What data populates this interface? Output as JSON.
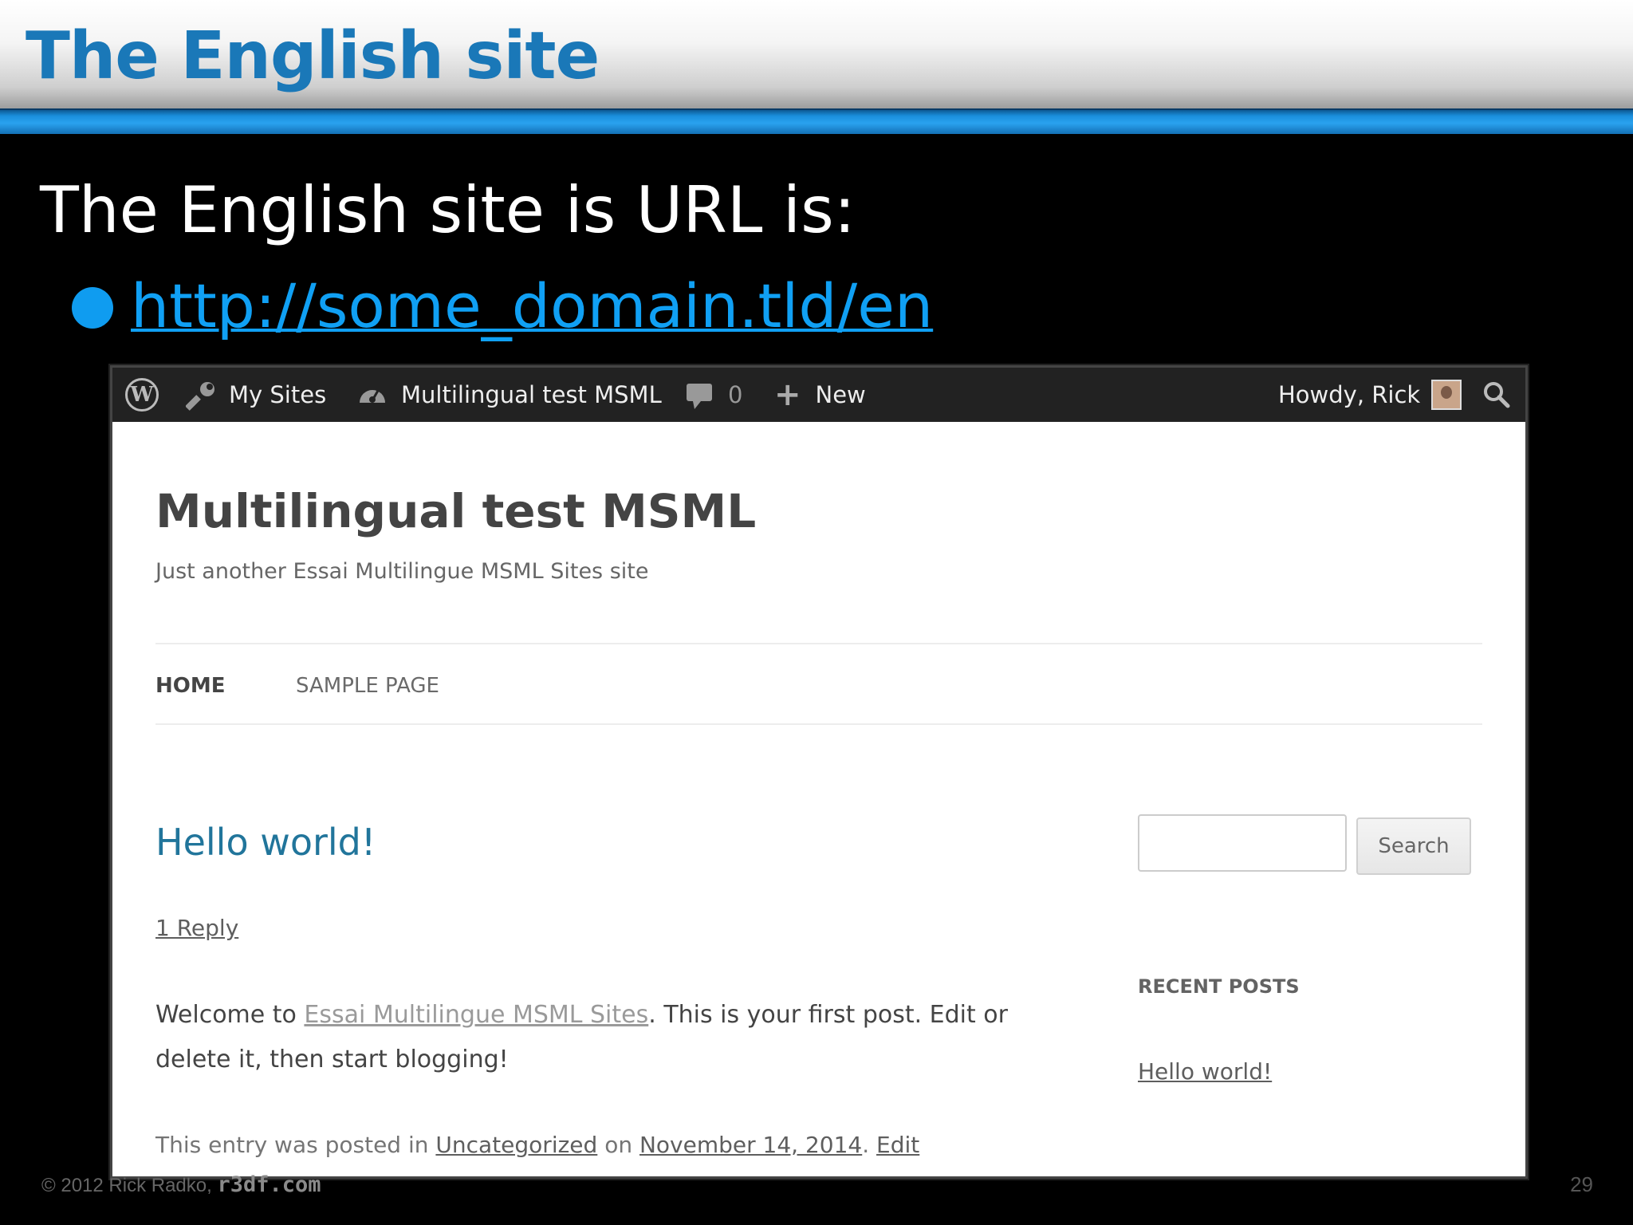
{
  "slide": {
    "title": "The English site",
    "subtitle": "The English site is URL is:",
    "url": "http://some_domain.tld/en",
    "footer_copyright": "© 2012  Rick Radko, ",
    "footer_brand": "r3df.com",
    "page_number": "29"
  },
  "admin_bar": {
    "my_sites": "My Sites",
    "site_name": "Multilingual test MSML",
    "comment_count": "0",
    "new_label": "New",
    "howdy": "Howdy, Rick"
  },
  "site": {
    "title": "Multilingual test MSML",
    "description": "Just another Essai Multilingue MSML Sites site",
    "nav": [
      "HOME",
      "SAMPLE PAGE"
    ]
  },
  "post": {
    "title": "Hello world!",
    "reply": "1 Reply",
    "body_pre": "Welcome to ",
    "body_link": "Essai Multilingue MSML Sites",
    "body_post": ". This is your first post. Edit or delete it, then start blogging!",
    "meta_1": "This entry was posted in ",
    "meta_category": "Uncategorized",
    "meta_2": " on ",
    "meta_date": "November 14, 2014",
    "meta_3": ". ",
    "meta_edit": "Edit"
  },
  "sidebar": {
    "search_button": "Search",
    "recent_posts_title": "RECENT POSTS",
    "recent_post": "Hello world!"
  }
}
